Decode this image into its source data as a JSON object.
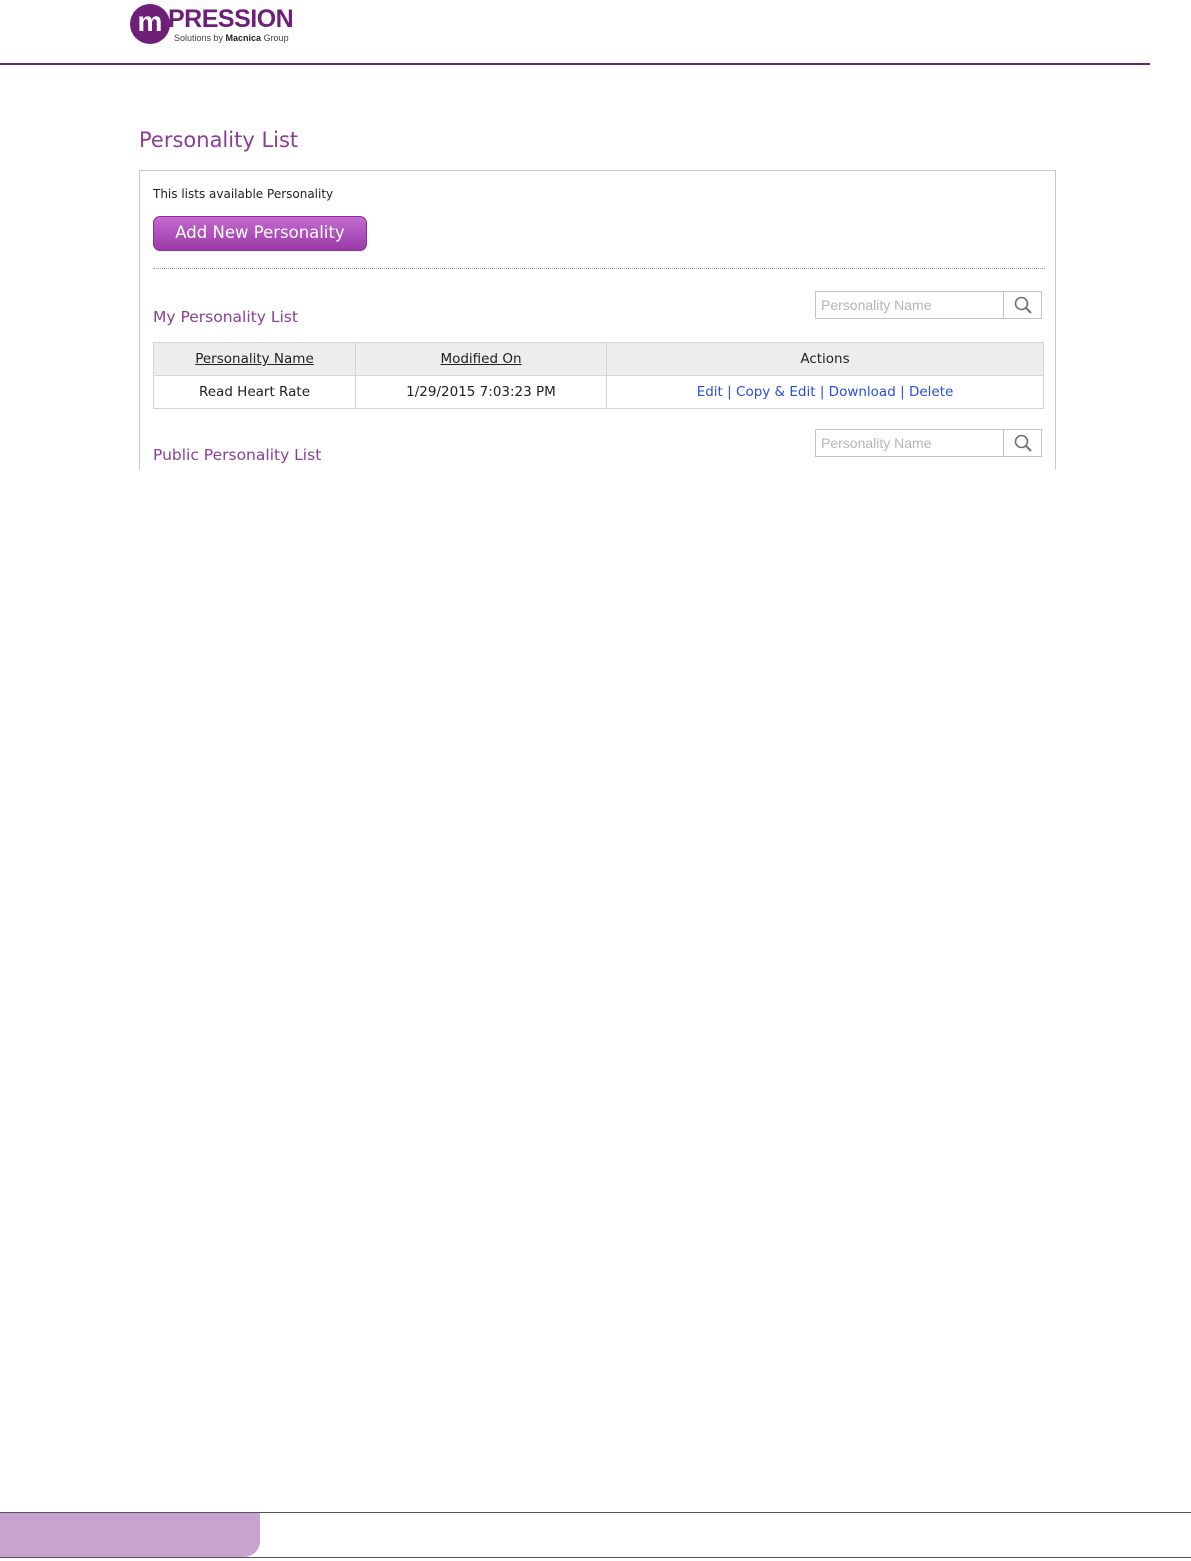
{
  "logo": {
    "mark": "m",
    "word": "PRESSION",
    "tagline_prefix": "Solutions by ",
    "tagline_brand": "Macnica",
    "tagline_suffix": " Group"
  },
  "page": {
    "title": "Personality List",
    "description": "This lists available Personality",
    "add_button_label": "Add New Personality"
  },
  "my_list": {
    "title": "My Personality List",
    "search": {
      "placeholder": "Personality Name",
      "value": ""
    },
    "columns": [
      "Personality Name",
      "Modified On",
      "Actions"
    ],
    "rows": [
      {
        "name": "Read Heart Rate",
        "modified_on": "1/29/2015 7:03:23 PM",
        "actions": [
          "Edit",
          "Copy & Edit",
          "Download",
          "Delete"
        ]
      }
    ]
  },
  "public_list": {
    "title": "Public Personality List",
    "search": {
      "placeholder": "Personality Name",
      "value": ""
    }
  },
  "icons": {
    "search": "search-icon"
  },
  "colors": {
    "brand": "#6e1f77",
    "accent": "#8a3e97",
    "button": "#a845b5",
    "link": "#2b4de0",
    "footer_tab": "#c9a3cf"
  }
}
